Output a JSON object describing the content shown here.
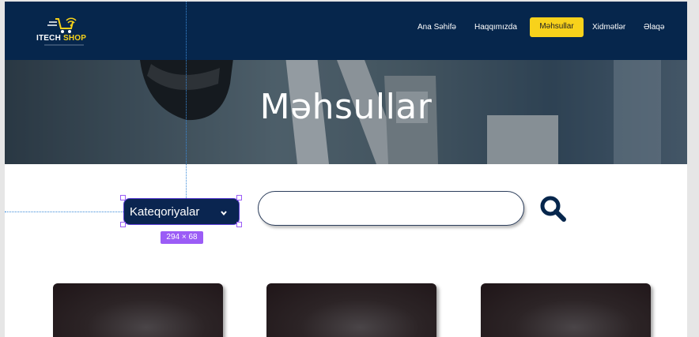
{
  "header": {
    "logo": {
      "text_white": "ITECH",
      "text_yellow": "SHOP"
    },
    "nav": [
      {
        "label": "Ana Səhifə",
        "active": false
      },
      {
        "label": "Haqqımızda",
        "active": false
      },
      {
        "label": "Məhsullar",
        "active": true
      },
      {
        "label": "Xidmətlər",
        "active": false
      },
      {
        "label": "Əlaqə",
        "active": false
      }
    ]
  },
  "hero": {
    "title": "Məhsullar"
  },
  "filters": {
    "category_select": {
      "label": "Kateqoriyalar"
    },
    "search": {
      "value": "",
      "placeholder": ""
    },
    "selection_size_badge": "294 × 68"
  },
  "colors": {
    "primary": "#06264c",
    "accent": "#f8d21b",
    "selection": "#9b5cf6"
  },
  "products": [
    {},
    {},
    {}
  ]
}
